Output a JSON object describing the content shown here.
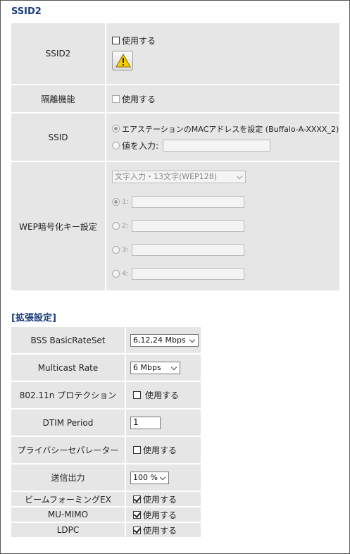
{
  "ssid2_section": {
    "title": "SSID2",
    "rows": {
      "ssid2_label": "SSID2",
      "ssid2_enable": "使用する",
      "isolation_label": "隔離機能",
      "isolation_enable": "使用する",
      "ssid_label": "SSID",
      "ssid_option_mac": "エアステーションのMACアドレスを設定 (Buffalo-A-XXXX_2)",
      "ssid_option_input": "値を入力:",
      "wep_label": "WEP暗号化キー設定",
      "wep_mode": "文字入力・13文字(WEP128)",
      "wep_keys": [
        "1:",
        "2:",
        "3:",
        "4:"
      ]
    }
  },
  "advanced_section": {
    "title": "[拡張設定]",
    "bss_label": "BSS BasicRateSet",
    "bss_value": "6,12,24 Mbps",
    "multicast_label": "Multicast Rate",
    "multicast_value": "6 Mbps",
    "protection_label": "802.11n プロテクション",
    "protection_enable": "使用する",
    "dtim_label": "DTIM Period",
    "dtim_value": "1",
    "privacy_label": "プライバシーセパレーター",
    "privacy_enable": "使用する",
    "power_label": "送信出力",
    "power_value": "100 %",
    "beam_label": "ビームフォーミングEX",
    "beam_enable": "使用する",
    "mumimo_label": "MU-MIMO",
    "mumimo_enable": "使用する",
    "ldpc_label": "LDPC",
    "ldpc_enable": "使用する"
  },
  "colors": {
    "title": "#1a3c7a",
    "cell_bg": "#e6e6e6",
    "warning_yellow": "#f5d000"
  }
}
